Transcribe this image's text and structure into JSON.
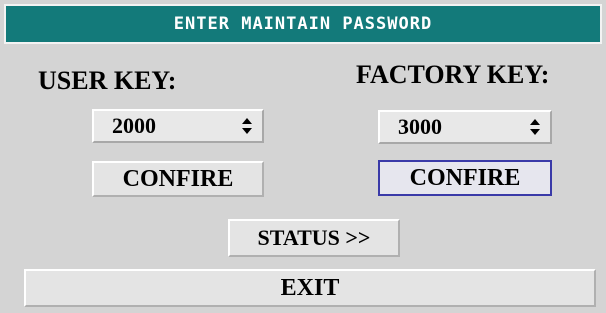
{
  "dialog": {
    "title": "ENTER MAINTAIN PASSWORD",
    "title_bar_color": "#137a7a"
  },
  "user_key": {
    "label": "USER KEY:",
    "value": "2000",
    "spinner_icon": "updown-arrows-icon",
    "confirm_label": "CONFIRE"
  },
  "factory_key": {
    "label": "FACTORY KEY:",
    "value": "3000",
    "spinner_icon": "updown-arrows-icon",
    "confirm_label": "CONFIRE",
    "confirm_focus_color": "#3a3aa8"
  },
  "buttons": {
    "status_label": "STATUS >>",
    "exit_label": "EXIT"
  }
}
